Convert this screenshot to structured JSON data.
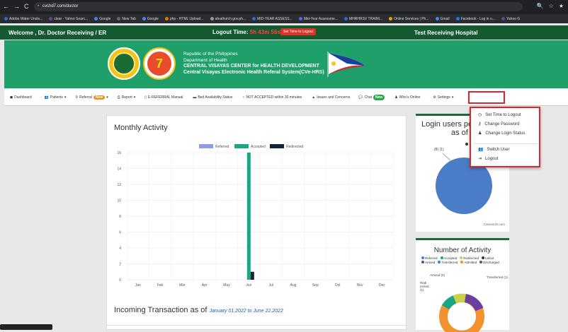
{
  "browser": {
    "url": "cvchd7.com/doctor",
    "bookmarks": [
      "Adobe Water Unsle...",
      "clear - Yahoo Searc...",
      "Google",
      "New Tab",
      "Google",
      "php - HTML Upload...",
      "afeathutch.gov.ph...",
      "MID-YEAR ASSESS...",
      "Mid-Year Assessme...",
      "MHRHRSV TRAINI...",
      "Online Services | Ph...",
      "Gmail",
      "Facebook - Log in o...",
      "Yahoo G"
    ]
  },
  "topbar": {
    "welcome": "Welcome , Dr. Doctor Receiving / ER",
    "logout_label": "Logout Time:",
    "logout_value": "5h 43m 56s",
    "set_time_button": "Set Time to Logout",
    "hospital": "Test Receiving Hospital"
  },
  "banner": {
    "line1": "Republic of the Philippines",
    "line2": "Department of Health",
    "line3": "CENTRAL VISAYAS CENTER for HEALTH DEVELOPMENT",
    "line4": "Central Visayas Electronic Health Referal System(CVe-HRS)"
  },
  "navbar": {
    "dashboard": "Dashboard",
    "patients": "Patients",
    "referral": "Referral",
    "referral_badge": "New",
    "report": "Report",
    "manual": "E-REFERRAL Manual",
    "bed": "Bed Availability Status",
    "not_accepted": "NOT ACCEPTED within 30 minutes",
    "issues": "Issues and Concerns",
    "chat": "Chat",
    "chat_badge": "New",
    "whos_online": "Who's Online",
    "settings": "Settings"
  },
  "settings_menu": {
    "items": [
      "Set Time to Logout",
      "Change Password",
      "Change Login Status",
      "Switch User",
      "Logout"
    ]
  },
  "main": {
    "title": "Monthly Activity",
    "incoming_title": "Incoming Transaction as of",
    "incoming_date": "January 01,2022 to June 22,2022"
  },
  "chart_data": {
    "type": "bar",
    "categories": [
      "Jan",
      "Feb",
      "Mar",
      "Apr",
      "May",
      "Jun",
      "Jul",
      "Aug",
      "Sep",
      "Oct",
      "Nov",
      "Dec"
    ],
    "series": [
      {
        "name": "Referred",
        "color": "#8e9de6",
        "values": [
          0,
          0,
          0,
          0,
          0,
          0,
          0,
          0,
          0,
          0,
          0,
          0
        ]
      },
      {
        "name": "Accepted",
        "color": "#1aa585",
        "values": [
          0,
          0,
          0,
          0,
          0,
          16,
          0,
          0,
          0,
          0,
          0,
          0
        ]
      },
      {
        "name": "Redirected",
        "color": "#13233b",
        "values": [
          0,
          0,
          0,
          0,
          0,
          1,
          0,
          0,
          0,
          0,
          0,
          0
        ]
      }
    ],
    "yticks": [
      "0",
      "2",
      "4",
      "6",
      "8",
      "10",
      "12",
      "14",
      "16"
    ],
    "ylim": [
      0,
      16
    ]
  },
  "right1": {
    "title_line1": "Login users per",
    "title_line2": "as of to",
    "pie_label": "(8) (1)",
    "credit": "CanvasJS.com"
  },
  "right2": {
    "title": "Number of Activity",
    "legend": [
      "Referred",
      "Accepted",
      "Redirected",
      "Lalout",
      "Arrived",
      "Transferred",
      "Admitted",
      "Discharged"
    ],
    "label_arrived": "Arrived (0)",
    "label_transferred": "Transferred (1)",
    "label_redirected": "Redi rected (1)"
  }
}
